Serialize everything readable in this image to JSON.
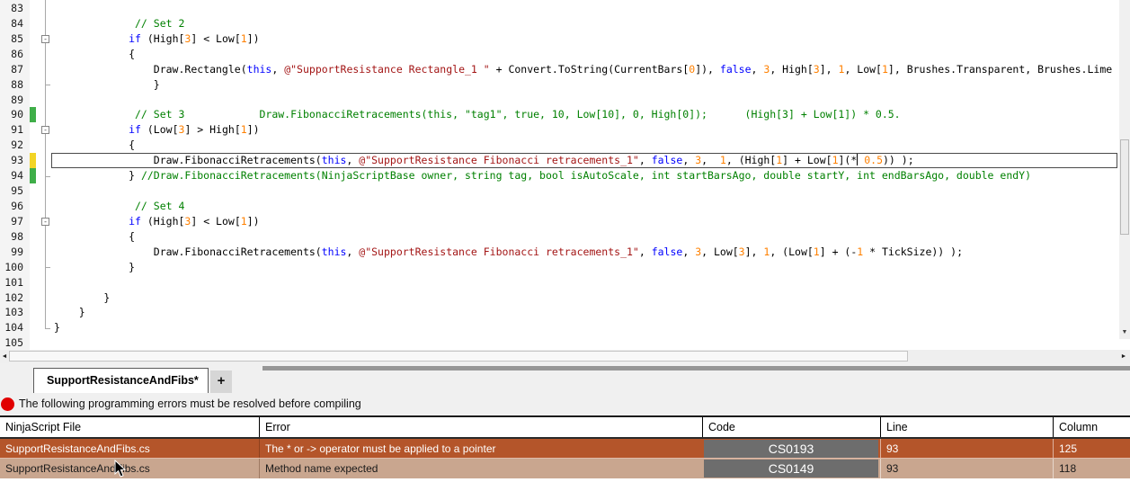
{
  "editor": {
    "base_line": 83,
    "current_line": 93,
    "indicators": {
      "green": [
        90,
        94
      ],
      "yellow": [
        93
      ]
    },
    "fold_open": [
      85,
      91,
      97
    ],
    "fold_end": [
      88,
      94,
      100,
      104
    ],
    "fold_glyph": "-",
    "lines": [
      {
        "n": 83,
        "t": []
      },
      {
        "n": 84,
        "t": [
          [
            "c",
            "             // Set 2"
          ]
        ]
      },
      {
        "n": 85,
        "t": [
          [
            "p",
            "            "
          ],
          [
            "k",
            "if"
          ],
          [
            "p",
            " (High["
          ],
          [
            "n",
            "3"
          ],
          [
            "p",
            "] < Low["
          ],
          [
            "n",
            "1"
          ],
          [
            "p",
            "])"
          ]
        ]
      },
      {
        "n": 86,
        "t": [
          [
            "p",
            "            {"
          ]
        ]
      },
      {
        "n": 87,
        "t": [
          [
            "p",
            "                Draw.Rectangle("
          ],
          [
            "k",
            "this"
          ],
          [
            "p",
            ", "
          ],
          [
            "s",
            "@\"SupportResistance Rectangle_1 \""
          ],
          [
            "p",
            " + Convert.ToString(CurrentBars["
          ],
          [
            "n",
            "0"
          ],
          [
            "p",
            "]), "
          ],
          [
            "k",
            "false"
          ],
          [
            "p",
            ", "
          ],
          [
            "n",
            "3"
          ],
          [
            "p",
            ", High["
          ],
          [
            "n",
            "3"
          ],
          [
            "p",
            "], "
          ],
          [
            "n",
            "1"
          ],
          [
            "p",
            ", Low["
          ],
          [
            "n",
            "1"
          ],
          [
            "p",
            "], Brushes.Transparent, Brushes.Lime"
          ]
        ]
      },
      {
        "n": 88,
        "t": [
          [
            "p",
            "                }"
          ]
        ]
      },
      {
        "n": 89,
        "t": []
      },
      {
        "n": 90,
        "t": [
          [
            "c",
            "             // Set 3            Draw.FibonacciRetracements(this, \"tag1\", true, 10, Low[10], 0, High[0]);      (High[3] + Low[1]) * 0.5."
          ]
        ]
      },
      {
        "n": 91,
        "t": [
          [
            "p",
            "            "
          ],
          [
            "k",
            "if"
          ],
          [
            "p",
            " (Low["
          ],
          [
            "n",
            "3"
          ],
          [
            "p",
            "] > High["
          ],
          [
            "n",
            "1"
          ],
          [
            "p",
            "])"
          ]
        ]
      },
      {
        "n": 92,
        "t": [
          [
            "p",
            "            {"
          ]
        ]
      },
      {
        "n": 93,
        "t": [
          [
            "p",
            "                Draw.FibonacciRetracements("
          ],
          [
            "k",
            "this"
          ],
          [
            "p",
            ", "
          ],
          [
            "s",
            "@\"SupportResistance Fibonacci retracements_1\""
          ],
          [
            "p",
            ", "
          ],
          [
            "k",
            "false"
          ],
          [
            "p",
            ", "
          ],
          [
            "n",
            "3"
          ],
          [
            "p",
            ",  "
          ],
          [
            "n",
            "1"
          ],
          [
            "p",
            ", (High["
          ],
          [
            "n",
            "1"
          ],
          [
            "p",
            "] + Low["
          ],
          [
            "n",
            "1"
          ],
          [
            "p",
            "](*"
          ],
          [
            "caret",
            ""
          ],
          [
            "p",
            " "
          ],
          [
            "n",
            "0.5"
          ],
          [
            "p",
            ")) );"
          ]
        ]
      },
      {
        "n": 94,
        "t": [
          [
            "p",
            "            } "
          ],
          [
            "c",
            "//Draw.FibonacciRetracements(NinjaScriptBase owner, string tag, bool isAutoScale, int startBarsAgo, double startY, int endBarsAgo, double endY)"
          ]
        ]
      },
      {
        "n": 95,
        "t": []
      },
      {
        "n": 96,
        "t": [
          [
            "c",
            "             // Set 4"
          ]
        ]
      },
      {
        "n": 97,
        "t": [
          [
            "p",
            "            "
          ],
          [
            "k",
            "if"
          ],
          [
            "p",
            " (High["
          ],
          [
            "n",
            "3"
          ],
          [
            "p",
            "] < Low["
          ],
          [
            "n",
            "1"
          ],
          [
            "p",
            "])"
          ]
        ]
      },
      {
        "n": 98,
        "t": [
          [
            "p",
            "            {"
          ]
        ]
      },
      {
        "n": 99,
        "t": [
          [
            "p",
            "                Draw.FibonacciRetracements("
          ],
          [
            "k",
            "this"
          ],
          [
            "p",
            ", "
          ],
          [
            "s",
            "@\"SupportResistance Fibonacci retracements_1\""
          ],
          [
            "p",
            ", "
          ],
          [
            "k",
            "false"
          ],
          [
            "p",
            ", "
          ],
          [
            "n",
            "3"
          ],
          [
            "p",
            ", Low["
          ],
          [
            "n",
            "3"
          ],
          [
            "p",
            "], "
          ],
          [
            "n",
            "1"
          ],
          [
            "p",
            ", (Low["
          ],
          [
            "n",
            "1"
          ],
          [
            "p",
            "] + (-"
          ],
          [
            "n",
            "1"
          ],
          [
            "p",
            " * TickSize)) );"
          ]
        ]
      },
      {
        "n": 100,
        "t": [
          [
            "p",
            "            }"
          ]
        ]
      },
      {
        "n": 101,
        "t": []
      },
      {
        "n": 102,
        "t": [
          [
            "p",
            "        }"
          ]
        ]
      },
      {
        "n": 103,
        "t": [
          [
            "p",
            "    }"
          ]
        ]
      },
      {
        "n": 104,
        "t": [
          [
            "p",
            "}"
          ]
        ]
      },
      {
        "n": 105,
        "t": []
      }
    ]
  },
  "tab": {
    "label": "SupportResistanceAndFibs*",
    "new_tab_label": "+"
  },
  "error_bar": {
    "message": "The following programming errors must be resolved before compiling"
  },
  "table": {
    "headers": [
      "NinjaScript File",
      "Error",
      "Code",
      "Line",
      "Column"
    ],
    "rows": [
      {
        "file": "SupportResistanceAndFibs.cs",
        "error": "The * or -> operator must be applied to a pointer",
        "code": "CS0193",
        "line": "93",
        "column": "125",
        "selected": true
      },
      {
        "file": "SupportResistanceAndFibs.cs",
        "error": "Method name expected",
        "code": "CS0149",
        "line": "93",
        "column": "118",
        "selected": false
      }
    ]
  },
  "scrollbar": {
    "left_arrow": "◄",
    "right_arrow": "►",
    "down_arrow": "▼"
  },
  "colors": {
    "syntax": {
      "plain": "#000000",
      "keyword": "#0000ff",
      "string": "#a31515",
      "number": "#ff8000",
      "comment": "#008000"
    },
    "indicator_green": "#3fae49",
    "indicator_yellow": "#f2d426",
    "error_icon": "#e10000",
    "row_selected_bg": "#b4552a",
    "row_selected_fg": "#ffffff",
    "row_alt_bg": "#c9a68f",
    "row_alt_fg": "#1a1a1a",
    "badge_bg": "#6d6d6d",
    "badge_fg": "#ffffff"
  }
}
